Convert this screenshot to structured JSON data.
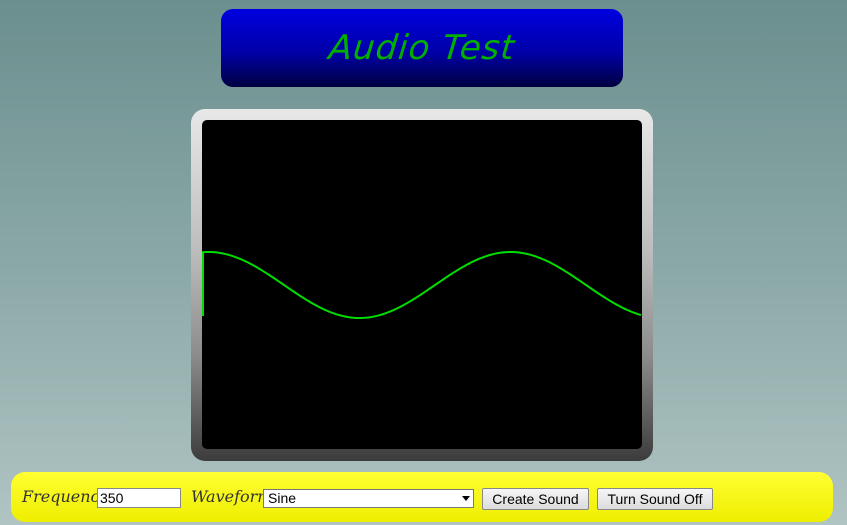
{
  "header": {
    "title": "Audio Test"
  },
  "scope": {
    "background": "#000000",
    "trace_color": "#00dd00",
    "waveform": "Sine"
  },
  "controls": {
    "frequency_label": "Frequency",
    "frequency_value": "350",
    "waveform_label": "Waveform",
    "waveform_selected": "Sine",
    "create_button": "Create Sound",
    "off_button": "Turn Sound Off"
  },
  "colors": {
    "title_text": "#00b000",
    "title_bg_top": "#0000e0",
    "control_bar": "#f0f000"
  }
}
